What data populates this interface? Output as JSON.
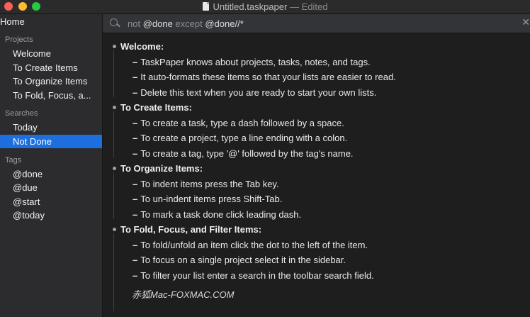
{
  "window": {
    "title": "Untitled.taskpaper",
    "separator": "—",
    "status": "Edited"
  },
  "sidebar": {
    "home_label": "Home",
    "projects_header": "Projects",
    "projects": [
      "Welcome",
      "To Create Items",
      "To Organize Items",
      "To Fold, Focus, a..."
    ],
    "searches_header": "Searches",
    "searches": [
      "Today",
      "Not Done"
    ],
    "selected_search": "Not Done",
    "tags_header": "Tags",
    "tags": [
      "@done",
      "@due",
      "@start",
      "@today"
    ]
  },
  "search": {
    "query_prefix": "not ",
    "query_tag1": "@done",
    "query_mid": " except ",
    "query_tag2": "@done",
    "query_suffix": "//*"
  },
  "document": {
    "projects": [
      {
        "title": "Welcome:",
        "tasks": [
          "TaskPaper knows about projects, tasks, notes, and tags.",
          "It auto-formats these items so that your lists are easier to read.",
          "Delete this text when you are ready to start your own lists."
        ]
      },
      {
        "title": "To Create Items:",
        "tasks": [
          "To create a task, type a dash followed by a space.",
          "To create a project, type a line ending with a colon.",
          "To create a tag, type '@' followed by the tag's name."
        ]
      },
      {
        "title": "To Organize Items:",
        "tasks": [
          "To indent items press the Tab key.",
          "To un-indent items press Shift-Tab.",
          "To mark a task done click leading dash."
        ]
      },
      {
        "title": "To Fold, Focus, and Filter Items:",
        "tasks": [
          "To fold/unfold an item click the dot to the left of the item.",
          "To focus on a single project select it in the sidebar.",
          "To filter your list enter a search in the toolbar search field."
        ]
      }
    ],
    "dash": "–",
    "watermark": "赤狐Mac-FOXMAC.COM"
  },
  "colors": {
    "selection": "#1d6fdf",
    "background": "#1e1e1f",
    "sidebar": "#2c2c2e"
  }
}
